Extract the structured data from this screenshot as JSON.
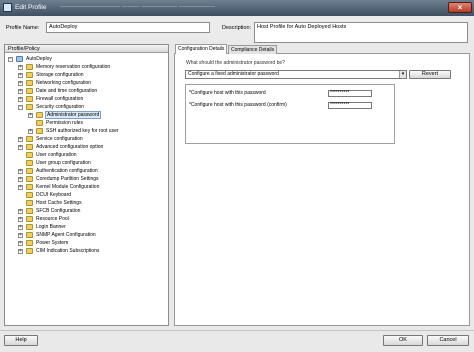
{
  "window": {
    "title": "Edit Profile",
    "ghost_title": "—————————— ——— —————— ——————"
  },
  "header": {
    "profile_name_label": "Profile Name:",
    "profile_name_value": "AutoDeploy",
    "description_label": "Description:",
    "description_value": "Host Profile for Auto Deployed  Hosts"
  },
  "tree": {
    "header": "Profile/Policy",
    "items": [
      {
        "label": "AutoDeploy"
      },
      {
        "label": "Memory reservation configuration"
      },
      {
        "label": "Storage configuration"
      },
      {
        "label": "Networking configuration"
      },
      {
        "label": "Date and time configuration"
      },
      {
        "label": "Firewall configuration"
      },
      {
        "label": "Security configuration"
      },
      {
        "label": "Administrator password"
      },
      {
        "label": "Permission rules"
      },
      {
        "label": "SSH authorized key for root user"
      },
      {
        "label": "Service configuration"
      },
      {
        "label": "Advanced configuration option"
      },
      {
        "label": "User configuration"
      },
      {
        "label": "User group configuration"
      },
      {
        "label": "Authentication configuration"
      },
      {
        "label": "Coredump Partition Settings"
      },
      {
        "label": "Kernel Module Configuration"
      },
      {
        "label": "DCUI Keyboard"
      },
      {
        "label": "Host Cache Settings"
      },
      {
        "label": "SFCB Configuration"
      },
      {
        "label": "Resource Pool"
      },
      {
        "label": "Login Banner"
      },
      {
        "label": "SNMP Agent Configuration"
      },
      {
        "label": "Power System"
      },
      {
        "label": "CIM Indication Subscriptions"
      }
    ]
  },
  "tabs": [
    {
      "label": "Configuration Details"
    },
    {
      "label": "Compliance Details"
    }
  ],
  "details": {
    "question": "What should the administrator password be?",
    "selected_option": "Configure a fixed administrator password",
    "revert_label": "Revert",
    "password_label": "*Configure host with this password",
    "password_value": "**********",
    "confirm_label": "*Configure host with this password (confirm)",
    "confirm_value": "**********"
  },
  "footer": {
    "help_label": "Help",
    "ok_label": "OK",
    "cancel_label": "Cancel"
  },
  "colors": {
    "title_bar": "#4f5f73",
    "folder": "#f0cf5f",
    "selection": "#dbe8f6"
  }
}
